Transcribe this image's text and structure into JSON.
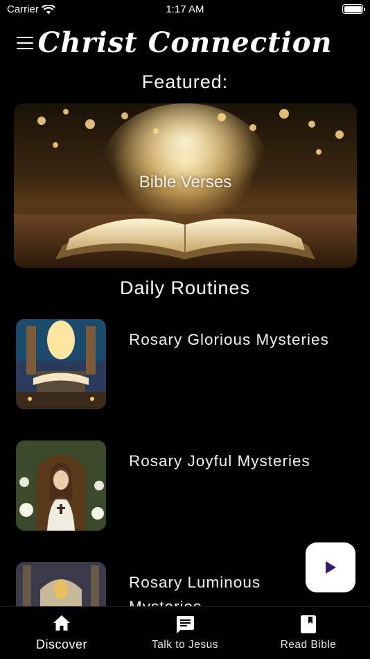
{
  "status_bar": {
    "carrier": "Carrier",
    "time": "1:17 AM"
  },
  "header": {
    "title": "Christ Connection"
  },
  "featured": {
    "heading": "Featured:",
    "card_title": "Bible Verses"
  },
  "routines": {
    "heading": "Daily Routines",
    "items": [
      {
        "label": "Rosary Glorious Mysteries"
      },
      {
        "label": "Rosary Joyful Mysteries"
      },
      {
        "label": "Rosary Luminous Mysteries"
      }
    ]
  },
  "tabs": [
    {
      "label": "Discover",
      "icon": "home-icon",
      "active": true
    },
    {
      "label": "Talk to Jesus",
      "icon": "chat-icon",
      "active": false
    },
    {
      "label": "Read Bible",
      "icon": "book-icon",
      "active": false
    }
  ],
  "colors": {
    "background": "#000000",
    "text": "#ffffff",
    "play_accent": "#3b1a6e"
  }
}
